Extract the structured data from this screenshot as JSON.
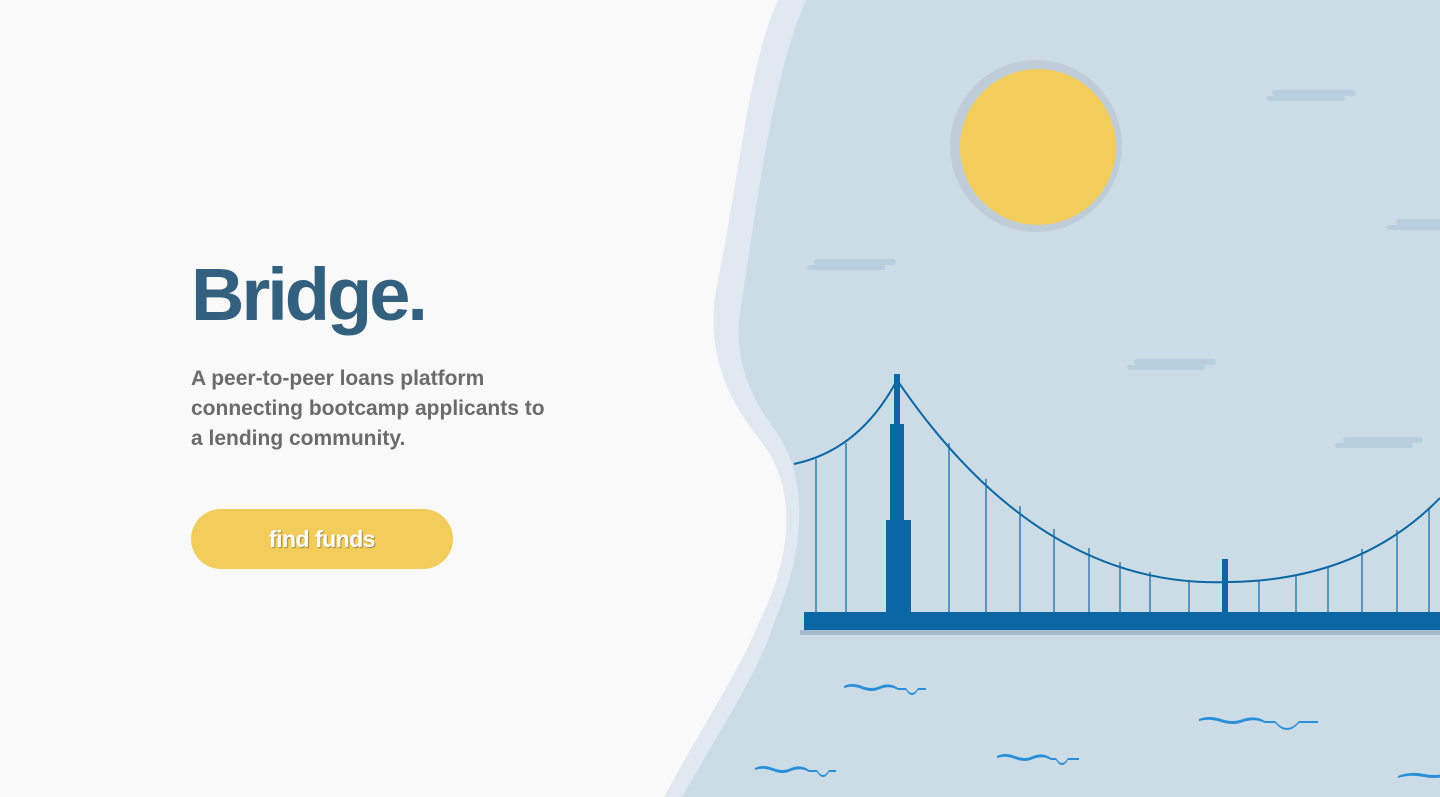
{
  "hero": {
    "title": "Bridge.",
    "tagline": "A peer-to-peer loans platform connecting bootcamp applicants to a lending community.",
    "cta_label": "find funds"
  },
  "colors": {
    "background": "#f9f9f9",
    "title": "#33607f",
    "tagline": "#6b6b6b",
    "button": "#f2cd5c",
    "sky": "#cbdce7",
    "sky_edge": "#e0e9f1",
    "sun": "#f2cd5c",
    "sun_halo": "#bfcdd8",
    "bridge": "#0b67a3",
    "water_ripple": "#2a8fd9",
    "cloud": "#b8cfdf"
  },
  "illustration": {
    "description_icon": "bridge-illustration-icon"
  }
}
